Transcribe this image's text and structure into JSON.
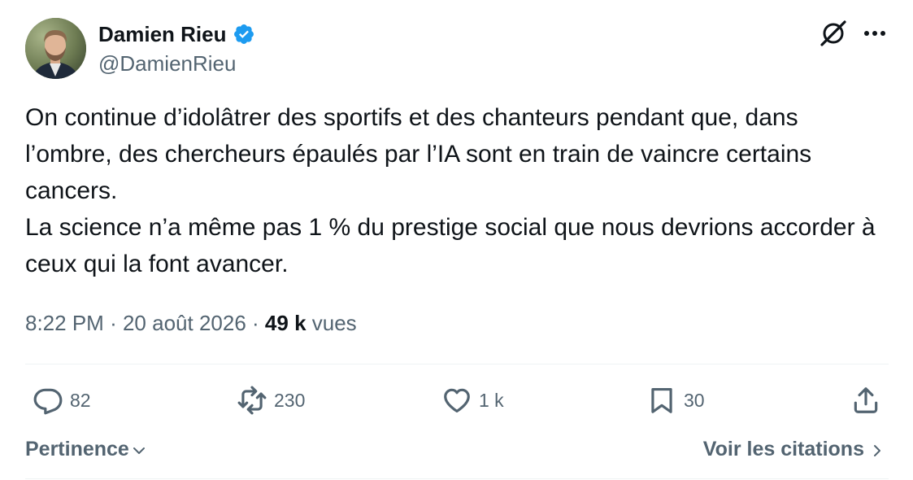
{
  "author": {
    "display_name": "Damien Rieu",
    "handle": "@DamienRieu",
    "verified": true,
    "verified_color": "#1d9bf0"
  },
  "header_icons": [
    "grok-icon",
    "more-icon"
  ],
  "tweet": {
    "paragraphs": [
      "On continue d’idolâtrer des sportifs et des chanteurs pendant que, dans l’ombre, des chercheurs épaulés par l’IA sont en train de vaincre certains cancers.",
      "La science n’a même pas 1 % du prestige social que nous devrions accorder à ceux qui la font avancer."
    ]
  },
  "meta": {
    "time": "8:22 PM",
    "separator": "·",
    "date": "20 août 2026",
    "views_count": "49 k",
    "views_label": "vues"
  },
  "actions": {
    "replies": "82",
    "reposts": "230",
    "likes": "1 k",
    "bookmarks": "30"
  },
  "footer": {
    "sort_label": "Pertinence",
    "quotes_label": "Voir les citations"
  },
  "colors": {
    "text_primary": "#0f1419",
    "text_secondary": "#536471",
    "divider": "#eff3f4"
  }
}
